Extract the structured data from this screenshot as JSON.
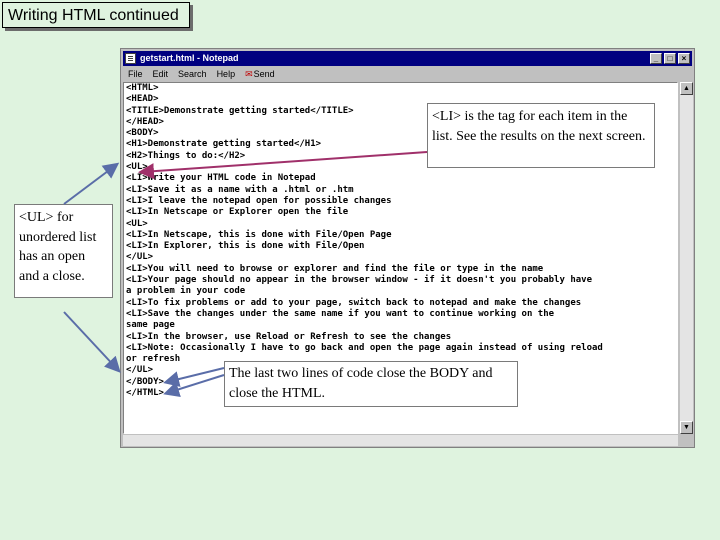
{
  "slide": {
    "title": "Writing HTML continued"
  },
  "window": {
    "title": "getstart.html - Notepad",
    "menus": [
      "File",
      "Edit",
      "Search",
      "Help",
      "Send"
    ],
    "code_lines": [
      "<HTML>",
      "<HEAD>",
      "<TITLE>Demonstrate getting started</TITLE>",
      "</HEAD>",
      "<BODY>",
      "<H1>Demonstrate getting started</H1>",
      "<H2>Things to do:</H2>",
      "<UL>",
      "<LI>Write your HTML code in Notepad",
      "<LI>Save it as a name with a .html or .htm",
      "<LI>I leave the notepad open for possible changes",
      "<LI>In Netscape or Explorer open the file",
      "<UL>",
      "<LI>In Netscape, this is done with File/Open Page",
      "<LI>In Explorer, this is done with File/Open",
      "</UL>",
      "<LI>You will need to browse or explorer and find the file or type in the name",
      "<LI>Your page should no appear in the browser window - if it doesn't you probably have",
      "a problem in your code",
      "<LI>To fix problems or add to your page, switch back to notepad and make the changes",
      "<LI>Save the changes under the same name if you want to continue working on the",
      "same page",
      "<LI>In the browser, use Reload or Refresh to see the changes",
      "<LI>Note: Occasionally I have to go back and open the page again instead of using reload",
      "or refresh",
      "</UL>",
      "</BODY>",
      "</HTML>"
    ]
  },
  "callouts": {
    "li_note": "<LI> is the tag for each item in the list.  See the results on the next screen.",
    "ul_note": "<UL> for unordered list has an open and a close.",
    "body_note": "The last two lines of code close the BODY and close the HTML."
  },
  "colors": {
    "background": "#dff3df",
    "titlebar": "#000080",
    "arrow_purple": "#a0306a",
    "arrow_blue": "#5a6da8"
  }
}
